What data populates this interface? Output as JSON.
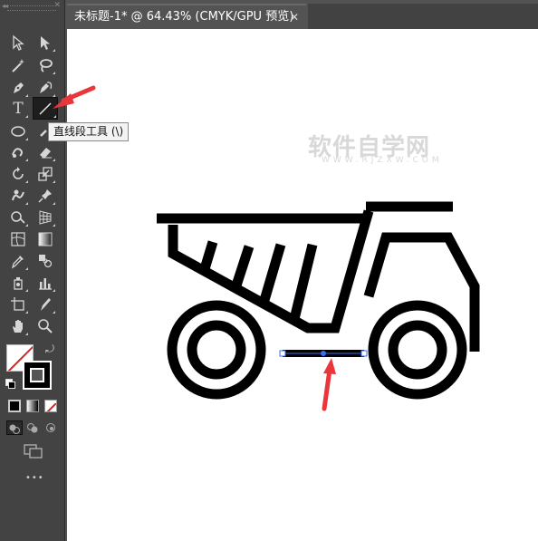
{
  "document": {
    "tab_title": "未标题-1* @ 64.43% (CMYK/GPU 预览)",
    "tab_close": "✕"
  },
  "toolbar": {
    "collapse": "◂◂",
    "close": "✕",
    "type_tool_glyph": "T",
    "tooltip": "直线段工具 (\\)",
    "more_tools": "•••",
    "tools": [
      "selection-tool",
      "direct-selection-tool",
      "magic-wand-tool",
      "lasso-tool",
      "pen-tool",
      "curvature-tool",
      "type-tool",
      "line-segment-tool",
      "ellipse-tool",
      "paintbrush-tool",
      "shaper-tool",
      "eraser-tool",
      "rotate-tool",
      "scale-tool",
      "warp-tool",
      "free-transform-tool",
      "shape-builder-tool",
      "perspective-grid-tool",
      "mesh-tool",
      "gradient-tool",
      "eyedropper-tool",
      "blend-tool",
      "symbol-sprayer-tool",
      "column-graph-tool",
      "artboard-tool",
      "slice-tool",
      "hand-tool",
      "zoom-tool"
    ],
    "active_tool": "line-segment-tool"
  },
  "watermark": {
    "text": "软件自学网",
    "url": "WWW.RJZXW.COM"
  },
  "colors": {
    "panel": "#434343",
    "workspace": "#535353",
    "artboard": "#ffffff",
    "annotation_arrow": "#e8363b",
    "selection_blue": "#3a6ff0"
  }
}
